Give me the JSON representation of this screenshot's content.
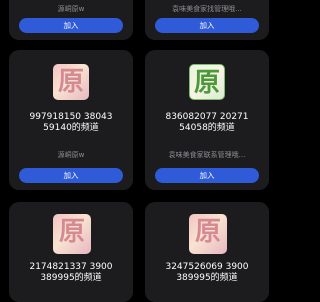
{
  "cards": [
    {
      "owner": "源峒原w",
      "join": "加入"
    },
    {
      "owner": "袁味美食家找管理哦...",
      "join": "加入"
    },
    {
      "name": "997918150 38043 59140的频道",
      "owner": "源峒原w",
      "join": "加入",
      "avatar_char": "原"
    },
    {
      "name": "836082077 20271 54058的频道",
      "owner": "袁味美食家联系管理哦...",
      "join": "加入",
      "avatar_char": "原"
    },
    {
      "name": "2174821337 3900 389995的频道",
      "avatar_char": "原"
    },
    {
      "name": "3247526069 3900 389995的频道",
      "avatar_char": "原"
    }
  ]
}
